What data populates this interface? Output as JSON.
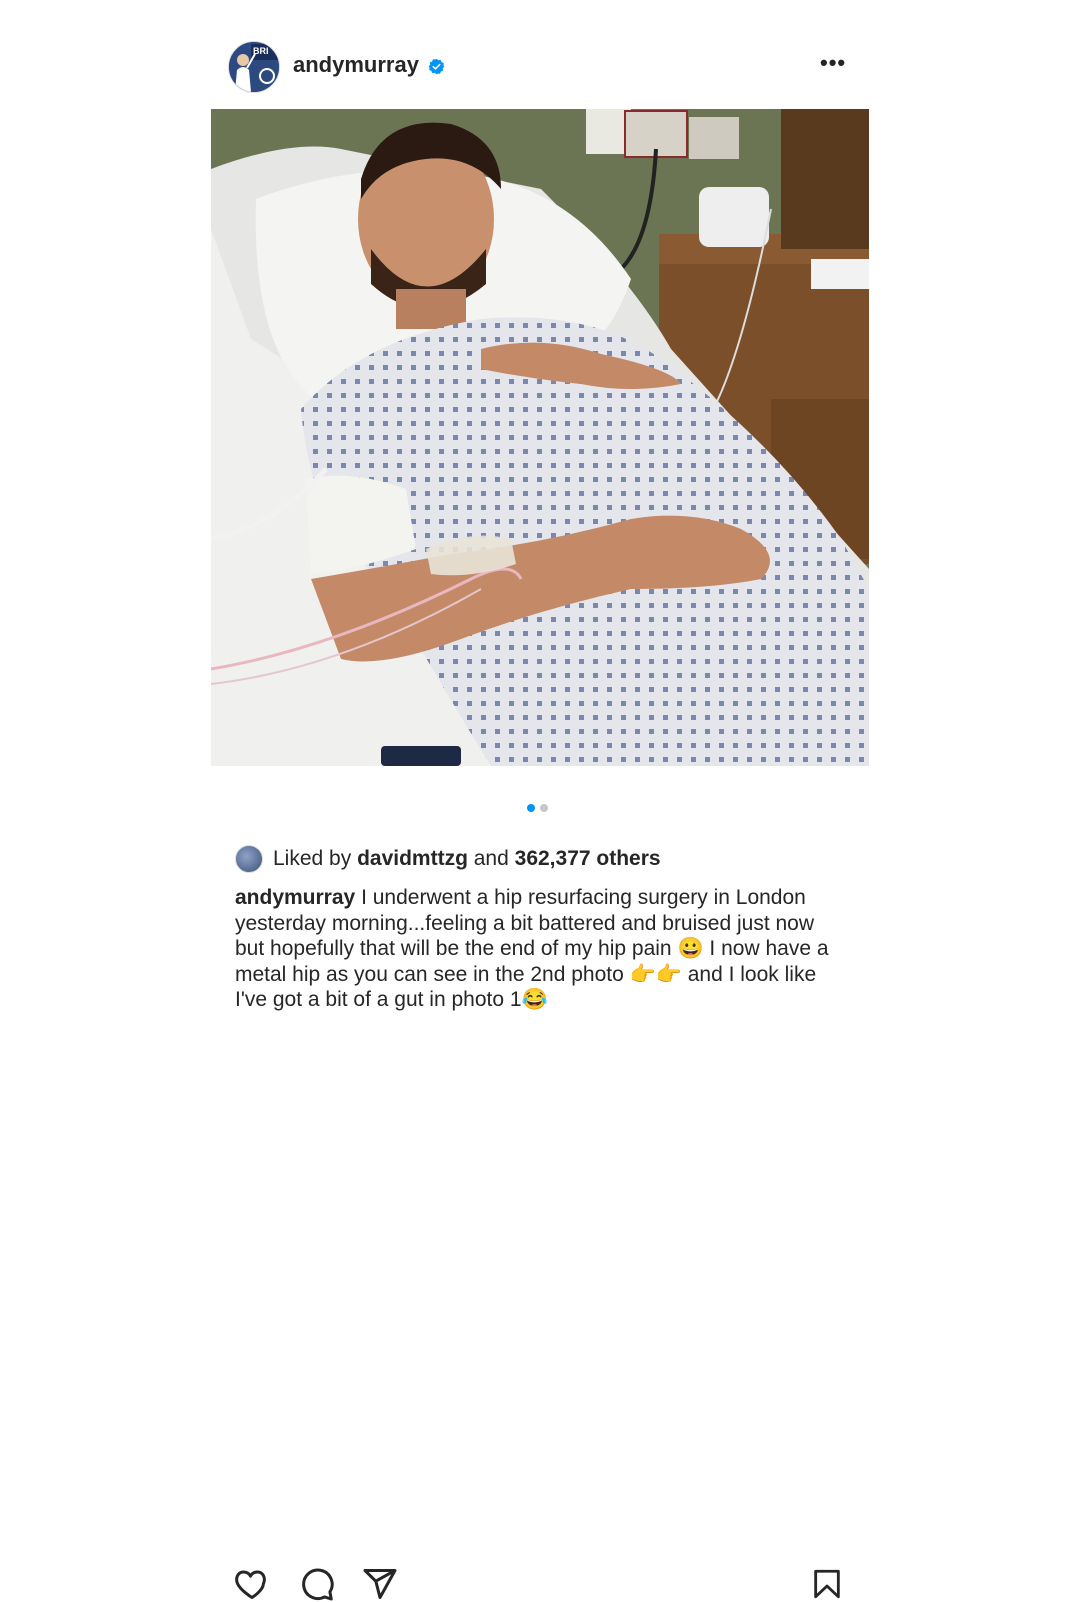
{
  "post": {
    "username": "andymurray",
    "avatar_badge": "BRI",
    "verified": true,
    "more_label": "•••",
    "carousel": {
      "total": 2,
      "current": 1
    },
    "likes": {
      "prefix": "Liked by",
      "liker": "davidmttzg",
      "connector": "and",
      "others": "362,377 others"
    },
    "caption": {
      "username": "andymurray",
      "text": "I underwent a hip resurfacing surgery in London yesterday morning...feeling a bit battered and bruised just now but hopefully that will be the end of my hip pain 😀 I now have a metal hip as you can see in the 2nd photo 👉👉 and I look like I've got a bit of a gut in photo 1😂"
    }
  },
  "icons": {
    "like": "heart-icon",
    "comment": "comment-icon",
    "share": "send-icon",
    "save": "bookmark-icon",
    "verified": "verified-badge-icon"
  },
  "colors": {
    "verified_blue": "#0095f6",
    "active_dot": "#0095f6",
    "inactive_dot": "#c7c7c7",
    "text": "#262626"
  }
}
